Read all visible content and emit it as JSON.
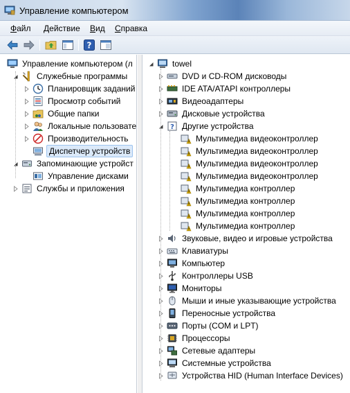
{
  "window": {
    "title": "Управление компьютером"
  },
  "menu": [
    {
      "label": "Файл",
      "accel": "Ф",
      "rest": "айл"
    },
    {
      "label": "Действие",
      "accel": "Д",
      "rest": "ействие"
    },
    {
      "label": "Вид",
      "accel": "В",
      "rest": "ид"
    },
    {
      "label": "Справка",
      "accel": "С",
      "rest": "правка"
    }
  ],
  "toolbar": {
    "buttons": [
      "back-arrow-icon",
      "forward-arrow-icon",
      "up-folder-icon",
      "show-hide-tree-icon",
      "help-icon",
      "properties-icon"
    ]
  },
  "left_tree": {
    "root": "Управление компьютером (л",
    "items": [
      {
        "label": "Служебные программы",
        "icon": "tools-icon",
        "level": 1,
        "expander": "expanded"
      },
      {
        "label": "Планировщик заданий",
        "icon": "task-scheduler-icon",
        "level": 2,
        "expander": "collapsed"
      },
      {
        "label": "Просмотр событий",
        "icon": "event-viewer-icon",
        "level": 2,
        "expander": "collapsed"
      },
      {
        "label": "Общие папки",
        "icon": "shared-folders-icon",
        "level": 2,
        "expander": "collapsed"
      },
      {
        "label": "Локальные пользовате",
        "icon": "local-users-icon",
        "level": 2,
        "expander": "collapsed"
      },
      {
        "label": "Производительность",
        "icon": "performance-icon",
        "level": 2,
        "expander": "collapsed"
      },
      {
        "label": "Диспетчер устройств",
        "icon": "device-manager-icon",
        "level": 2,
        "expander": "none",
        "selected": true
      },
      {
        "label": "Запоминающие устройст",
        "icon": "storage-icon",
        "level": 1,
        "expander": "expanded"
      },
      {
        "label": "Управление дисками",
        "icon": "disk-management-icon",
        "level": 2,
        "expander": "none"
      },
      {
        "label": "Службы и приложения",
        "icon": "services-icon",
        "level": 1,
        "expander": "collapsed"
      }
    ]
  },
  "device_tree": {
    "root": "towel",
    "items": [
      {
        "label": "DVD и CD-ROM дисководы",
        "icon": "dvd-drive-icon",
        "level": 1,
        "expander": "collapsed"
      },
      {
        "label": "IDE ATA/ATAPI контроллеры",
        "icon": "ide-controller-icon",
        "level": 1,
        "expander": "collapsed"
      },
      {
        "label": "Видеоадаптеры",
        "icon": "display-adapter-icon",
        "level": 1,
        "expander": "collapsed"
      },
      {
        "label": "Дисковые устройства",
        "icon": "disk-drive-icon",
        "level": 1,
        "expander": "collapsed"
      },
      {
        "label": "Другие устройства",
        "icon": "unknown-device-icon",
        "level": 1,
        "expander": "expanded"
      },
      {
        "label": "Мультимедиа видеоконтроллер",
        "icon": "warning-device-icon",
        "level": 2,
        "expander": "none"
      },
      {
        "label": "Мультимедиа видеоконтроллер",
        "icon": "warning-device-icon",
        "level": 2,
        "expander": "none"
      },
      {
        "label": "Мультимедиа видеоконтроллер",
        "icon": "warning-device-icon",
        "level": 2,
        "expander": "none"
      },
      {
        "label": "Мультимедиа видеоконтроллер",
        "icon": "warning-device-icon",
        "level": 2,
        "expander": "none"
      },
      {
        "label": "Мультимедиа контроллер",
        "icon": "warning-device-icon",
        "level": 2,
        "expander": "none"
      },
      {
        "label": "Мультимедиа контроллер",
        "icon": "warning-device-icon",
        "level": 2,
        "expander": "none"
      },
      {
        "label": "Мультимедиа контроллер",
        "icon": "warning-device-icon",
        "level": 2,
        "expander": "none"
      },
      {
        "label": "Мультимедиа контроллер",
        "icon": "warning-device-icon",
        "level": 2,
        "expander": "none"
      },
      {
        "label": "Звуковые, видео и игровые устройства",
        "icon": "sound-device-icon",
        "level": 1,
        "expander": "collapsed"
      },
      {
        "label": "Клавиатуры",
        "icon": "keyboard-icon",
        "level": 1,
        "expander": "collapsed"
      },
      {
        "label": "Компьютер",
        "icon": "computer-icon",
        "level": 1,
        "expander": "collapsed"
      },
      {
        "label": "Контроллеры USB",
        "icon": "usb-icon",
        "level": 1,
        "expander": "collapsed"
      },
      {
        "label": "Мониторы",
        "icon": "monitor-icon",
        "level": 1,
        "expander": "collapsed"
      },
      {
        "label": "Мыши и иные указывающие устройства",
        "icon": "mouse-icon",
        "level": 1,
        "expander": "collapsed"
      },
      {
        "label": "Переносные устройства",
        "icon": "portable-device-icon",
        "level": 1,
        "expander": "collapsed"
      },
      {
        "label": "Порты (COM и LPT)",
        "icon": "port-icon",
        "level": 1,
        "expander": "collapsed"
      },
      {
        "label": "Процессоры",
        "icon": "processor-icon",
        "level": 1,
        "expander": "collapsed"
      },
      {
        "label": "Сетевые адаптеры",
        "icon": "network-adapter-icon",
        "level": 1,
        "expander": "collapsed"
      },
      {
        "label": "Системные устройства",
        "icon": "system-device-icon",
        "level": 1,
        "expander": "collapsed"
      },
      {
        "label": "Устройства HID (Human Interface Devices)",
        "icon": "hid-icon",
        "level": 1,
        "expander": "collapsed"
      }
    ]
  }
}
